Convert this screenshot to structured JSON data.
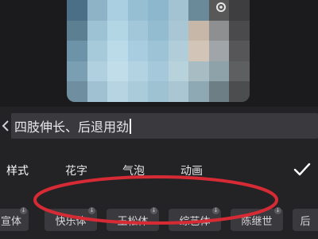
{
  "preview": {
    "palette": [
      "#4a6f86",
      "#8fb3c6",
      "#a9cfe0",
      "#97bfd4",
      "#8db7cd",
      "#a3c3d3",
      "#6b8a99",
      "#585858",
      "#3e3e40",
      "#5c7f92",
      "#9dc2d4",
      "#b3d6e5",
      "#a1c7d9",
      "#94bcd0",
      "#a8c6d4",
      "#c7b7a8",
      "#8d8f90",
      "#4a4a4c",
      "#6c93a7",
      "#a7cadb",
      "#bcdbe8",
      "#a9cde0",
      "#9cc3d6",
      "#b0cdd9",
      "#d2c4b7",
      "#9fa5a8",
      "#565658",
      "#7a9fb3",
      "#b0d0df",
      "#c0dde9",
      "#b3d3e2",
      "#a5c9da",
      "#b8d2dc",
      "#a8bcc4",
      "#8ea2aa",
      "#5d5f61",
      "#6f8fa0",
      "#9fc1d1",
      "#b6d4e1",
      "#aacbda",
      "#9fc2d2",
      "#a9c6d2",
      "#8fa9b4",
      "#6d7e85",
      "#4b4d4f"
    ]
  },
  "editor": {
    "text_value": "四肢伸长、后退用劲",
    "tabs": [
      {
        "label": "样式",
        "active": true
      },
      {
        "label": "花字",
        "active": false
      },
      {
        "label": "气泡",
        "active": false
      },
      {
        "label": "动画",
        "active": false
      }
    ],
    "fonts": [
      {
        "label": "宣体"
      },
      {
        "label": "快乐体"
      },
      {
        "label": "玉松体"
      },
      {
        "label": "综艺体"
      },
      {
        "label": "陈继世"
      },
      {
        "label": "后"
      }
    ],
    "highlight_color": "#d62b35"
  }
}
